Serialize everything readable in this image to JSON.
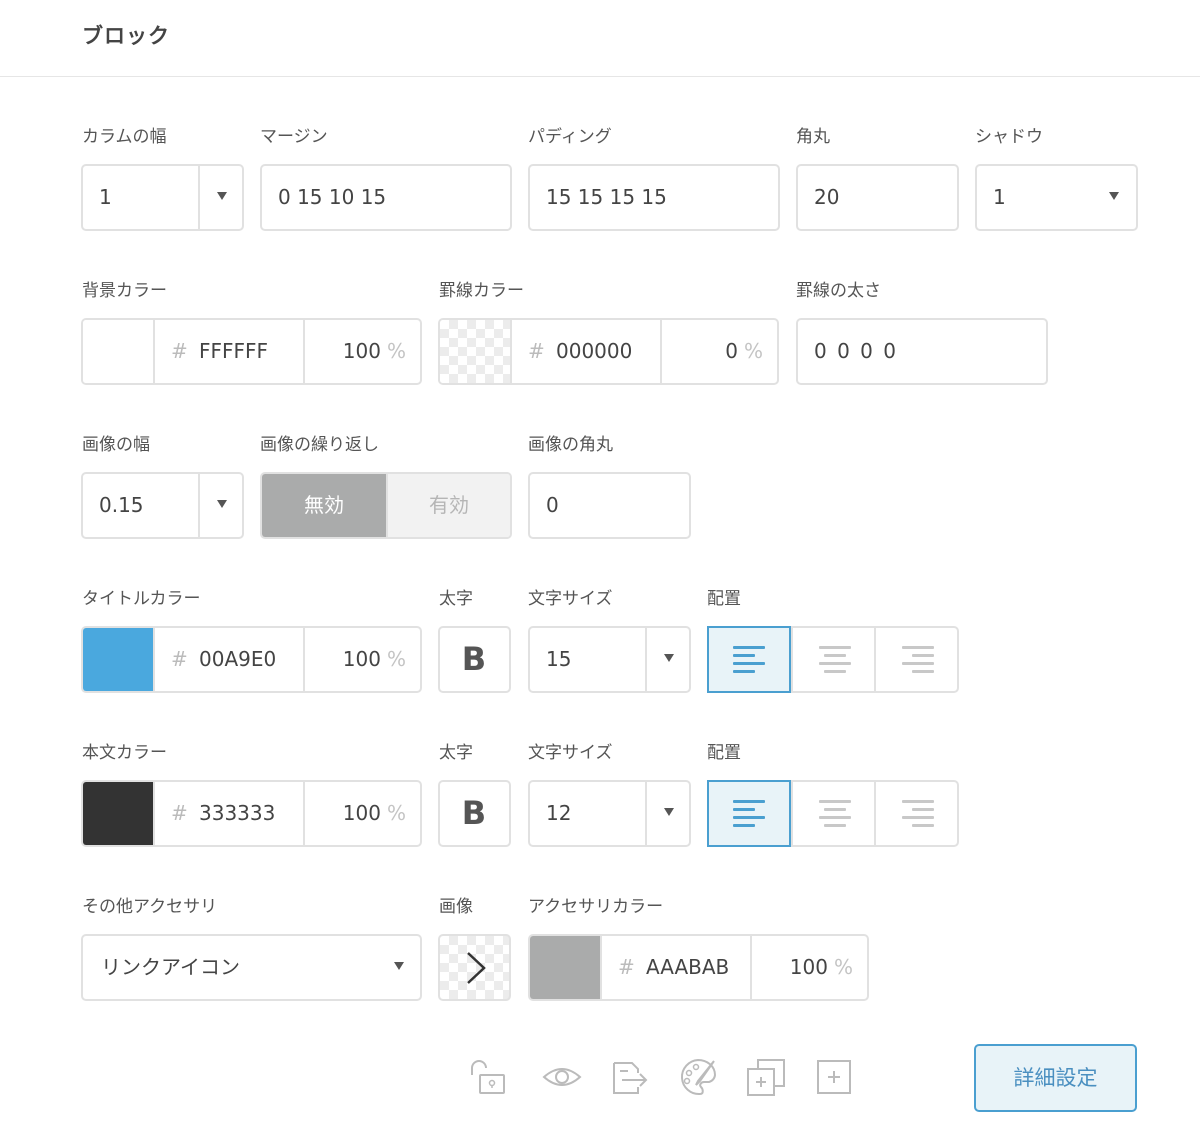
{
  "header": {
    "title": "ブロック"
  },
  "row1": {
    "column_width": {
      "label": "カラムの幅",
      "value": "1"
    },
    "margin": {
      "label": "マージン",
      "value": "0 15 10 15"
    },
    "padding": {
      "label": "パディング",
      "value": "15 15 15 15"
    },
    "radius": {
      "label": "角丸",
      "value": "20"
    },
    "shadow": {
      "label": "シャドウ",
      "value": "1"
    }
  },
  "row2": {
    "bg_color": {
      "label": "背景カラー",
      "hash": "#",
      "hex": "FFFFFF",
      "opacity": "100",
      "unit": "%",
      "swatch": "#ffffff"
    },
    "border_color": {
      "label": "罫線カラー",
      "hash": "#",
      "hex": "000000",
      "opacity": "0",
      "unit": "%",
      "swatch": "transparent"
    },
    "border_width": {
      "label": "罫線の太さ",
      "value": "0 0 0 0"
    }
  },
  "row3": {
    "image_width": {
      "label": "画像の幅",
      "value": "0.15"
    },
    "image_repeat": {
      "label": "画像の繰り返し",
      "off": "無効",
      "on": "有効"
    },
    "image_radius": {
      "label": "画像の角丸",
      "value": "0"
    }
  },
  "row4": {
    "title_color": {
      "label": "タイトルカラー",
      "hash": "#",
      "hex": "00A9E0",
      "opacity": "100",
      "unit": "%",
      "swatch": "#4aa8de"
    },
    "bold": {
      "label": "太字",
      "glyph": "B"
    },
    "font_size": {
      "label": "文字サイズ",
      "value": "15"
    },
    "align": {
      "label": "配置",
      "active": "left"
    }
  },
  "row5": {
    "body_color": {
      "label": "本文カラー",
      "hash": "#",
      "hex": "333333",
      "opacity": "100",
      "unit": "%",
      "swatch": "#333333"
    },
    "bold": {
      "label": "太字",
      "glyph": "B"
    },
    "font_size": {
      "label": "文字サイズ",
      "value": "12"
    },
    "align": {
      "label": "配置",
      "active": "left"
    }
  },
  "row6": {
    "accessory": {
      "label": "その他アクセサリ",
      "value": "リンクアイコン"
    },
    "image": {
      "label": "画像",
      "icon": "chevron-right-icon"
    },
    "accessory_color": {
      "label": "アクセサリカラー",
      "hash": "#",
      "hex": "AAABAB",
      "opacity": "100",
      "unit": "%",
      "swatch": "#aaabab"
    }
  },
  "toolbar": {
    "icons": [
      "unlock-icon",
      "eye-icon",
      "export-icon",
      "palette-icon",
      "duplicate-icon",
      "add-icon"
    ],
    "detail_button": "詳細設定"
  },
  "colors": {
    "accent": "#4a9fd0",
    "border": "#e1e1e1",
    "text": "#444444"
  }
}
